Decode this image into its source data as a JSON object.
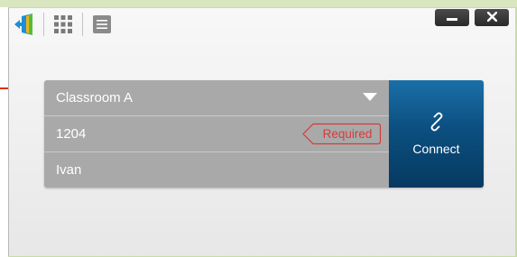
{
  "toolbar": {
    "app_icon": "app-logo-icon",
    "grid_icon": "grid-icon",
    "menu_icon": "menu-icon"
  },
  "window_controls": {
    "minimize_icon": "minimize-icon",
    "close_icon": "close-icon",
    "minimize_glyph": "−",
    "close_glyph": "✕"
  },
  "form": {
    "classroom": {
      "value": "Classroom A"
    },
    "code": {
      "value": "1204",
      "required_badge": "Required"
    },
    "name": {
      "value": "Ivan"
    }
  },
  "connect": {
    "label": "Connect",
    "icon": "link-icon"
  },
  "colors": {
    "frame_green": "#c8dca6",
    "field_gray": "#a9a9a9",
    "connect_blue": "#0c4f80",
    "required_red": "#d93a3a"
  }
}
